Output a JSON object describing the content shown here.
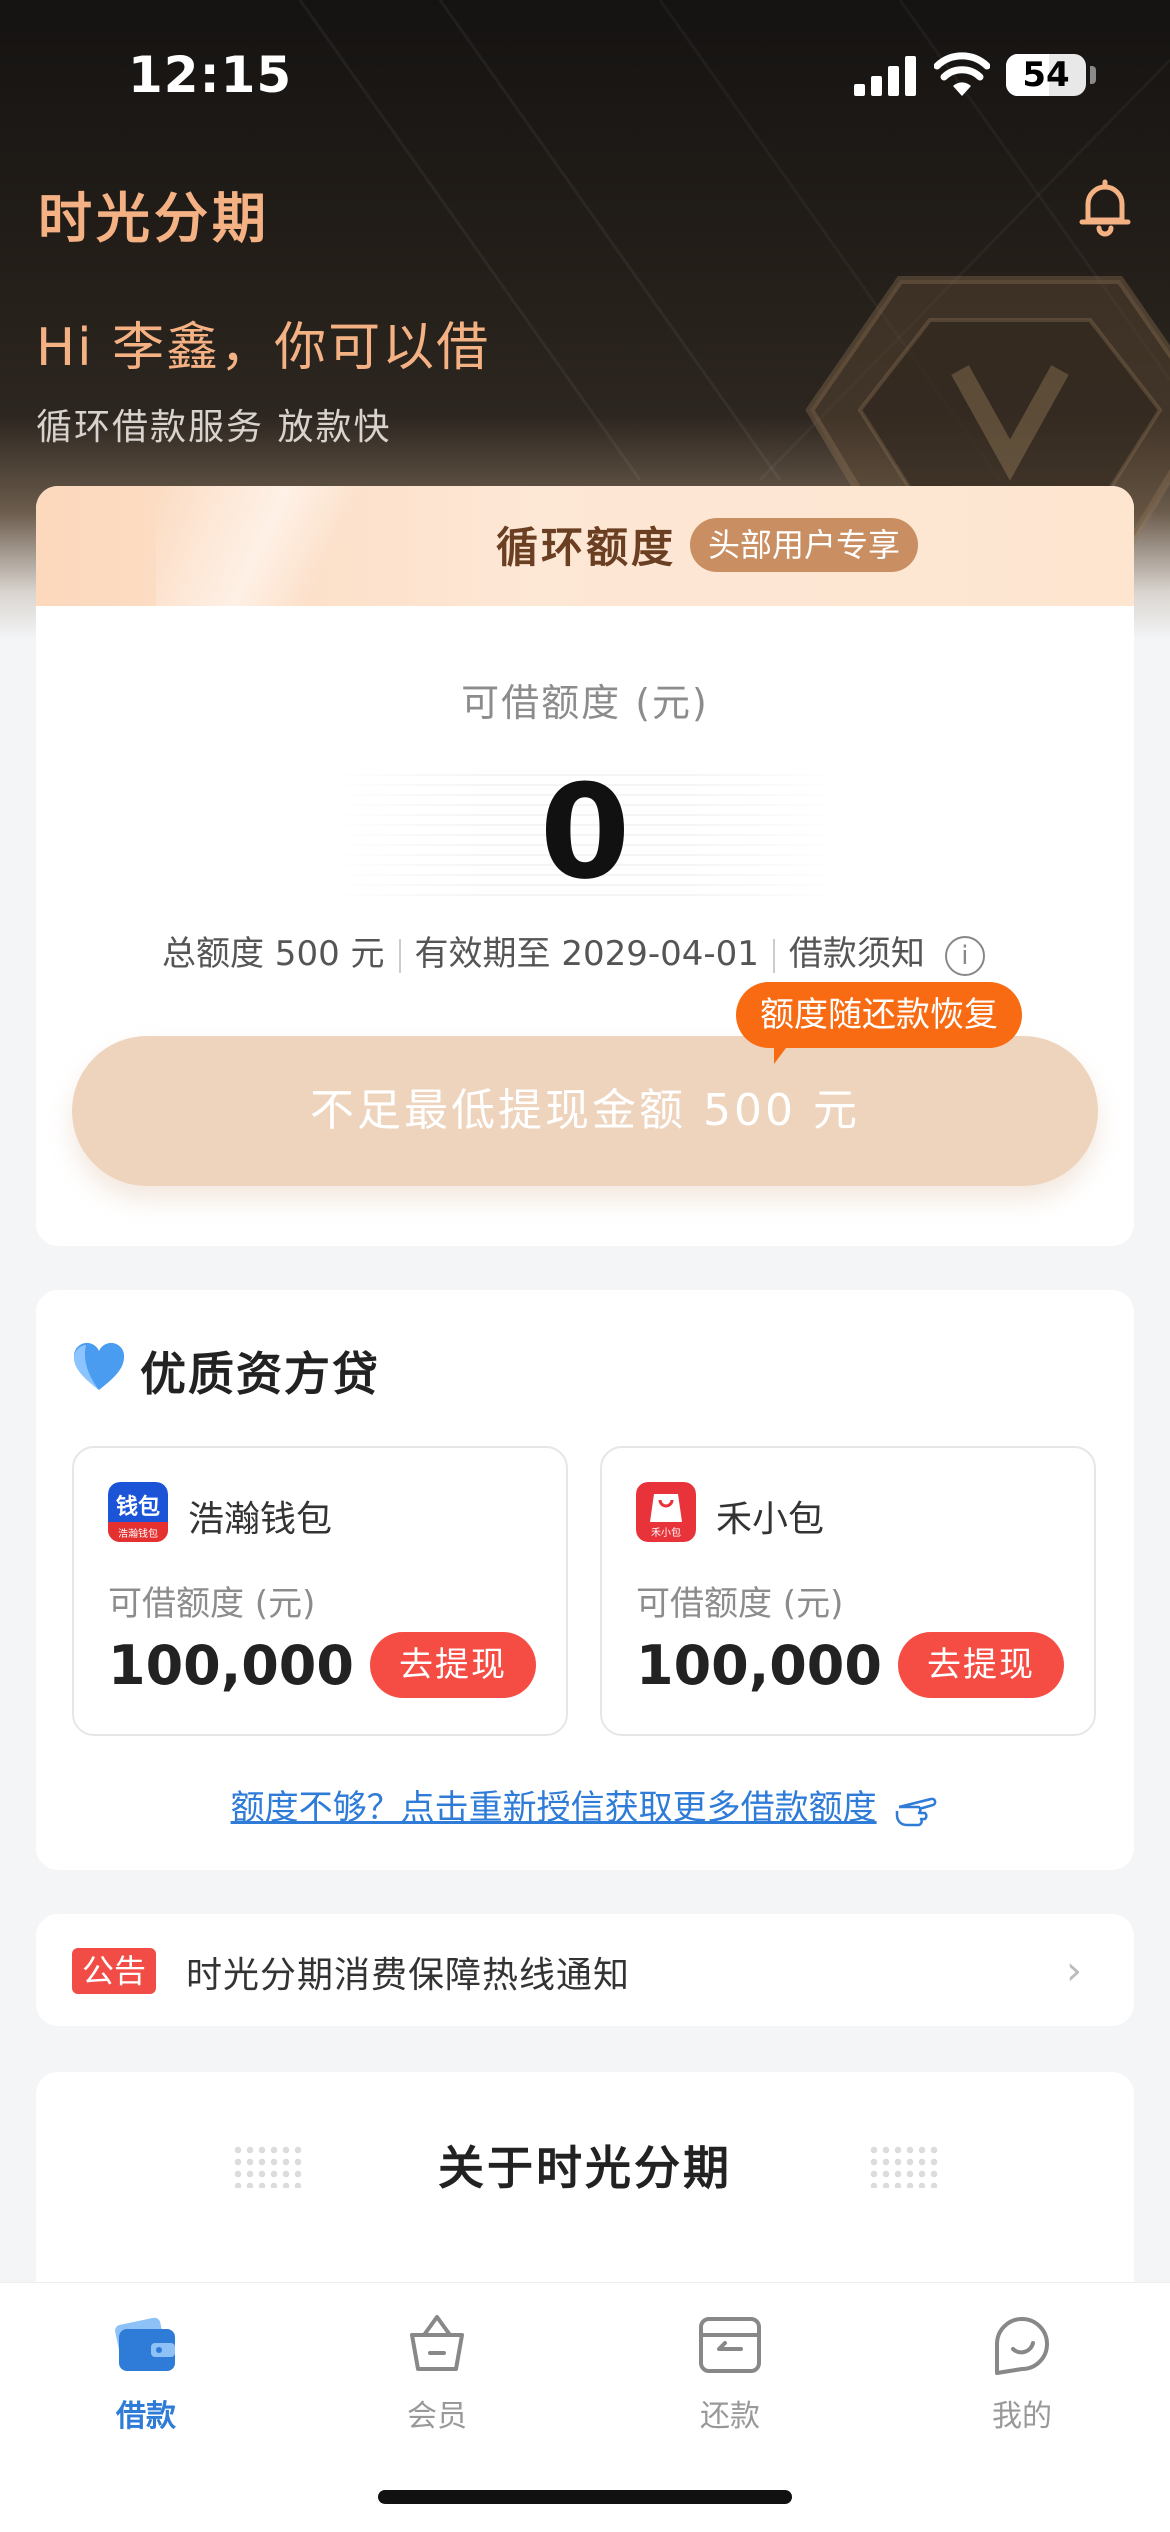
{
  "status_bar": {
    "time": "12:15",
    "battery": "54",
    "battery_level": 0.54
  },
  "header": {
    "brand": "时光分期",
    "greeting": "Hi 李鑫，你可以借",
    "subtitle": "循环借款服务 放款快"
  },
  "credit_card": {
    "title": "循环额度",
    "tag": "头部用户专享",
    "available_label": "可借额度 (元)",
    "available_amount": "0",
    "total_limit": "总额度 500 元",
    "valid_until": "有效期至 2029-04-01",
    "loan_notice": "借款须知",
    "tip": "额度随还款恢复",
    "withdraw_button": "不足最低提现金额 500 元"
  },
  "quality_loans": {
    "title": "优质资方贷",
    "lenders": [
      {
        "name": "浩瀚钱包",
        "logo_text": "钱包",
        "logo_sub": "浩瀚钱包",
        "label": "可借额度 (元)",
        "amount": "100,000",
        "button": "去提现"
      },
      {
        "name": "禾小包",
        "logo_text": "禾小包",
        "label": "可借额度 (元)",
        "amount": "100,000",
        "button": "去提现"
      }
    ],
    "reauth_link": "额度不够？点击重新授信获取更多借款额度"
  },
  "notice": {
    "badge": "公告",
    "text": "时光分期消费保障热线通知"
  },
  "about": {
    "title": "关于时光分期"
  },
  "tabbar": {
    "active_color": "#2e7bd8",
    "tabs": [
      {
        "label": "借款",
        "icon": "wallet-icon",
        "active": true
      },
      {
        "label": "会员",
        "icon": "basket-icon",
        "active": false
      },
      {
        "label": "还款",
        "icon": "repay-card-icon",
        "active": false
      },
      {
        "label": "我的",
        "icon": "profile-face-icon",
        "active": false
      }
    ]
  },
  "colors": {
    "brand": "#f4b184",
    "accent_orange": "#f86b13",
    "button_red": "#f54c44",
    "link_blue": "#2e7bd8"
  }
}
